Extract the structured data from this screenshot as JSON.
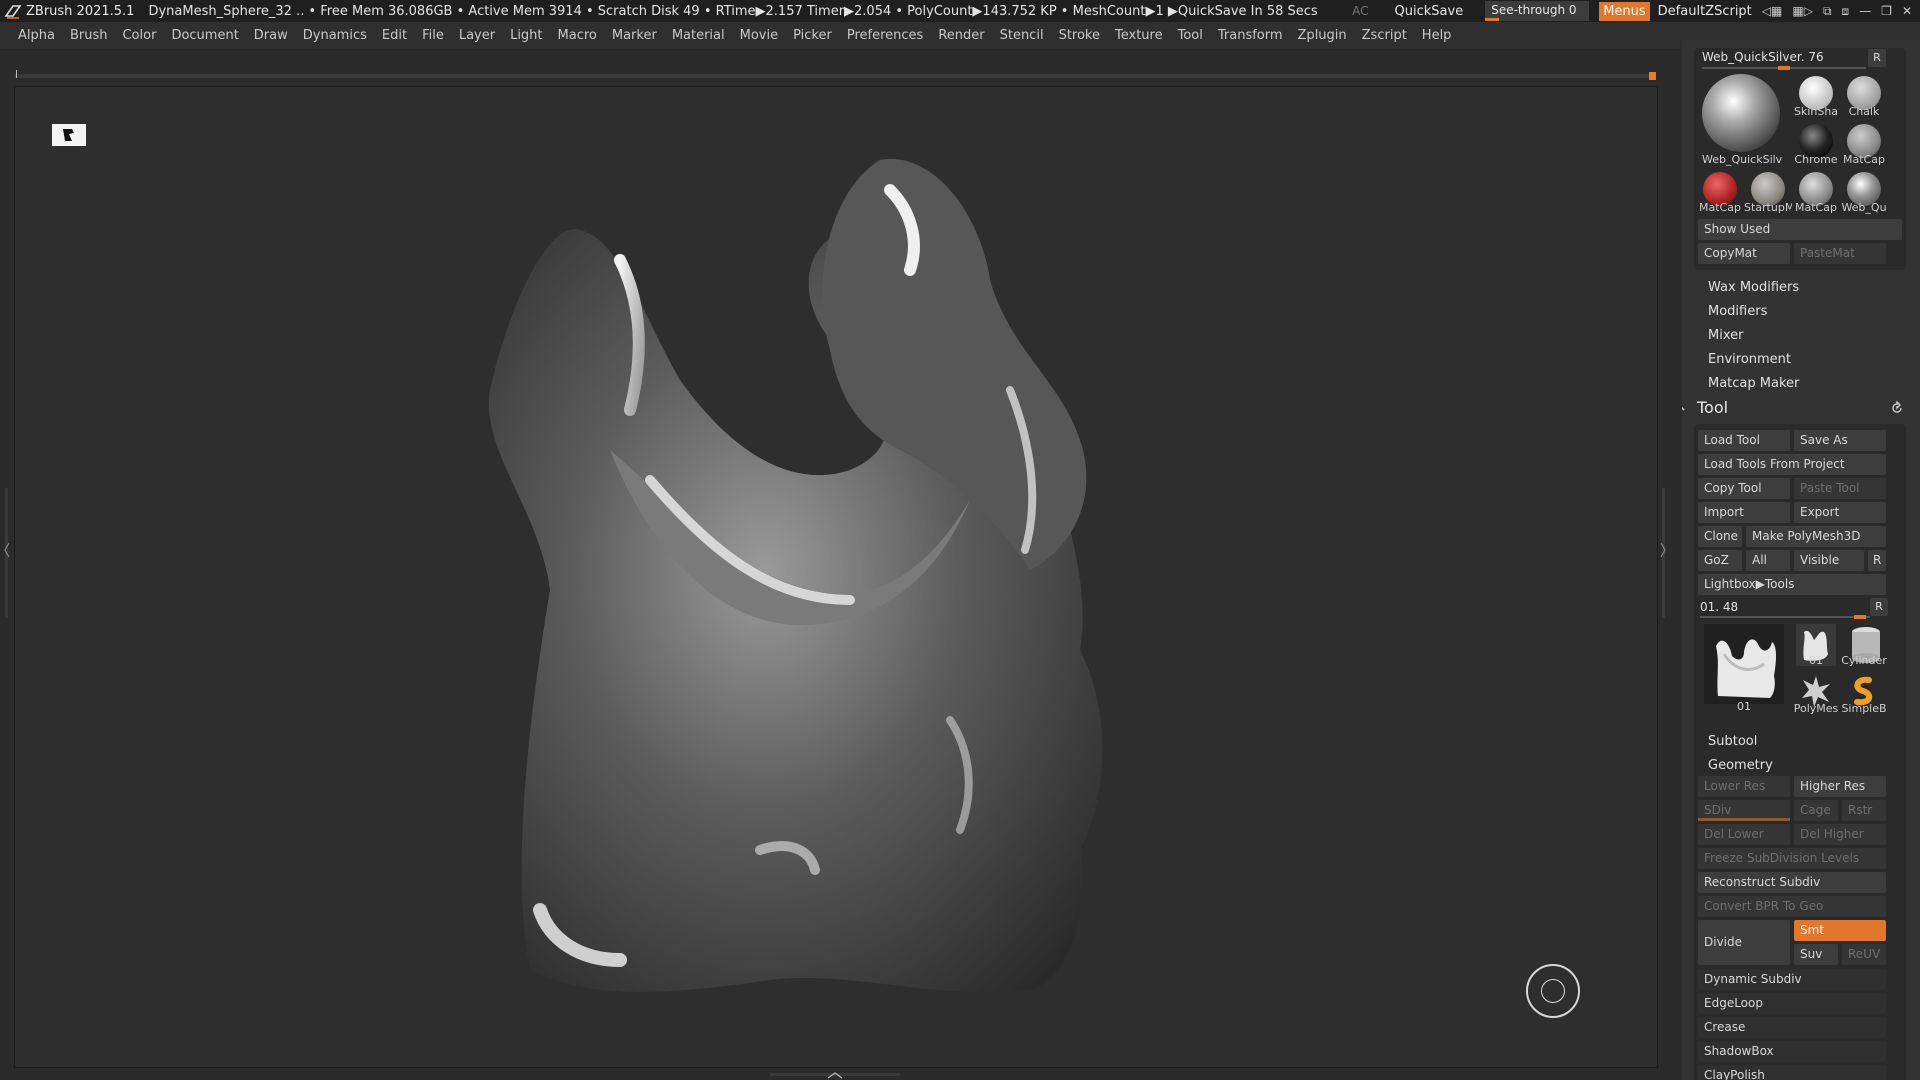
{
  "titlebar": {
    "app_title": "ZBrush 2021.5.1",
    "status": "DynaMesh_Sphere_32   .. • Free Mem 36.086GB • Active Mem 3914 • Scratch Disk 49 •   RTime▶2.157 Timer▶2.054 • PolyCount▶143.752 KP  • MeshCount▶1  ▶QuickSave In 58 Secs",
    "ac": "AC",
    "quicksave": "QuickSave",
    "see_through": "See-through  0",
    "see_through_value": 0,
    "menus": "Menus",
    "default_zscript": "DefaultZScript"
  },
  "menubar": [
    "Alpha",
    "Brush",
    "Color",
    "Document",
    "Draw",
    "Dynamics",
    "Edit",
    "File",
    "Layer",
    "Light",
    "Macro",
    "Marker",
    "Material",
    "Movie",
    "Picker",
    "Preferences",
    "Render",
    "Stencil",
    "Stroke",
    "Texture",
    "Tool",
    "Transform",
    "Zplugin",
    "Zscript",
    "Help"
  ],
  "material": {
    "name": "Web_QuickSilver. 76",
    "r": "R",
    "current_label": "Web_QuickSilver",
    "swatches": [
      "SkinSha",
      "Chalk",
      "Chrome",
      "MatCap",
      "MatCap",
      "StartupM",
      "MatCap",
      "Web_Qu"
    ],
    "show_used": "Show Used",
    "copy_mat": "CopyMat",
    "paste_mat": "PasteMat"
  },
  "sections": [
    "Wax Modifiers",
    "Modifiers",
    "Mixer",
    "Environment",
    "Matcap Maker"
  ],
  "tool": {
    "title": "Tool",
    "load_tool": "Load Tool",
    "save_as": "Save As",
    "load_from_project": "Load Tools From Project",
    "copy_tool": "Copy Tool",
    "paste_tool": "Paste Tool",
    "import": "Import",
    "export": "Export",
    "clone": "Clone",
    "make_polymesh": "Make PolyMesh3D",
    "goz": "GoZ",
    "all": "All",
    "visible": "Visible",
    "r": "R",
    "lightbox_tools": "Lightbox▶Tools",
    "slider_label": "01. 48",
    "current_tool_label": "01",
    "tools": [
      "01",
      "Cylinder",
      "PolyMes",
      "SimpleB"
    ]
  },
  "subtool": "Subtool",
  "geometry": {
    "title": "Geometry",
    "lower_res": "Lower Res",
    "higher_res": "Higher Res",
    "sdiv": "SDiv",
    "cage": "Cage",
    "rstr": "Rstr",
    "del_lower": "Del Lower",
    "del_higher": "Del Higher",
    "freeze": "Freeze SubDivision Levels",
    "reconstruct": "Reconstruct Subdiv",
    "convert_bpr": "Convert BPR To Geo",
    "divide": "Divide",
    "smt": "Smt",
    "suv": "Suv",
    "reuv": "ReUV",
    "items": [
      "Dynamic Subdiv",
      "EdgeLoop",
      "Crease",
      "ShadowBox",
      "ClayPolish"
    ]
  },
  "colors": {
    "accent": "#e0772a",
    "panel": "#333333",
    "canvas": "#2e2e2e"
  }
}
